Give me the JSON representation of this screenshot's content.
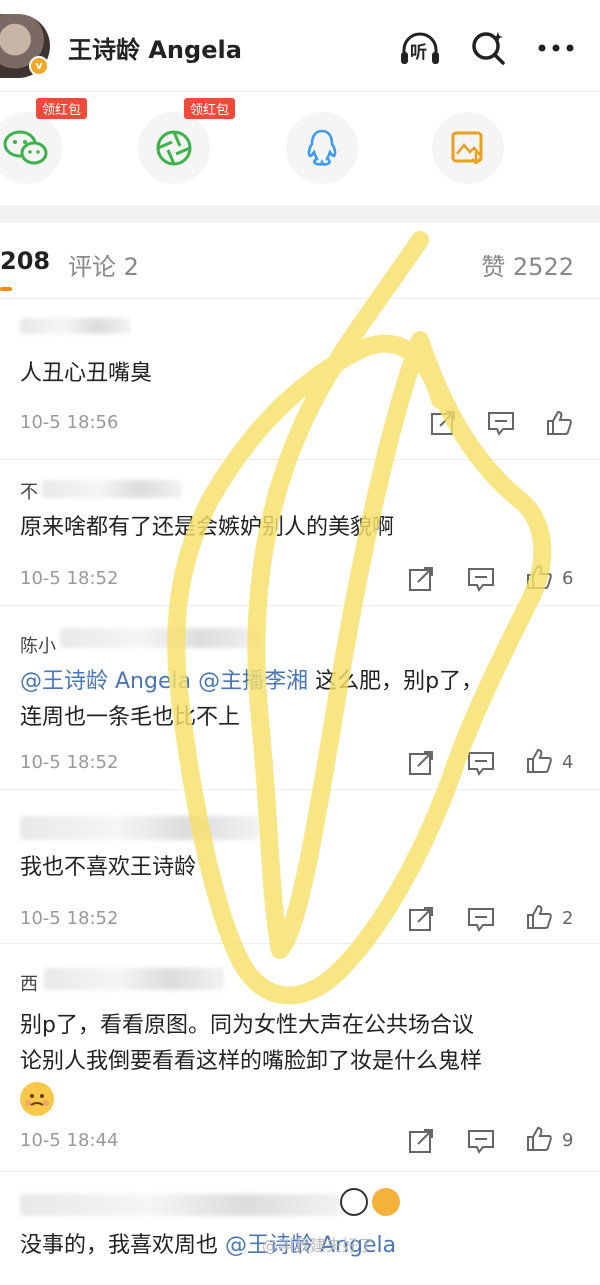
{
  "header": {
    "user_name": "王诗龄 Angela",
    "listen_label": "听",
    "icons": [
      "listen-icon",
      "search-icon",
      "more-icon"
    ]
  },
  "share": {
    "items": [
      {
        "name": "wechat",
        "badge": "领红包"
      },
      {
        "name": "moments",
        "badge": "领红包"
      },
      {
        "name": "qq",
        "badge": ""
      },
      {
        "name": "save-image",
        "badge": ""
      }
    ]
  },
  "tabs": {
    "repost": "208",
    "comments": "评论 2",
    "likes": "赞 2522"
  },
  "comments": [
    {
      "text": "人丑心丑嘴臭",
      "time": "10-5 18:56",
      "likes": ""
    },
    {
      "author_visible": "不",
      "text": "原来啥都有了还是会嫉妒别人的美貌啊",
      "time": "10-5 18:52",
      "likes": "6"
    },
    {
      "author_visible": "陈小",
      "mention1": "@王诗龄 Angela",
      "mention2": "@主播李湘",
      "text_a": " 这么肥，别p了，",
      "text_b": "连周也一条毛也比不上",
      "time": "10-5 18:52",
      "likes": "4"
    },
    {
      "text": "我也不喜欢王诗龄",
      "time": "10-5 18:52",
      "likes": "2"
    },
    {
      "author_visible": "西",
      "text_a": "别p了，看看原图。同为女性大声在公共场合议",
      "text_b": "论别人我倒要看看这样的嘴脸卸了妆是什么鬼样",
      "time": "10-5 18:44",
      "likes": "9"
    },
    {
      "text": "没事的，我喜欢周也 ",
      "mention": "@王诗龄 Angela"
    }
  ],
  "watermark": "@叫我建夫好了",
  "colors": {
    "accent": "#f28a1e",
    "mention": "#4a76b5",
    "redpack": "#f24a3a",
    "scribble": "#f6e06a"
  }
}
